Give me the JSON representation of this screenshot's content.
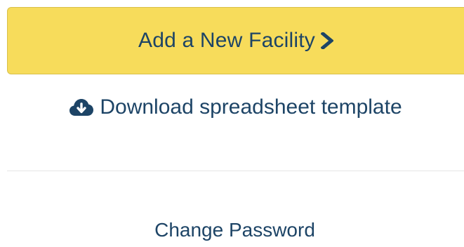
{
  "actions": {
    "add_facility_label": "Add a New Facility",
    "download_template_label": "Download spreadsheet template",
    "change_password_label": "Change Password"
  },
  "icons": {
    "add_facility": "chevron-right-icon",
    "download_template": "cloud-download-icon"
  },
  "colors": {
    "button_bg": "#f7dc5b",
    "text": "#1d4466"
  }
}
